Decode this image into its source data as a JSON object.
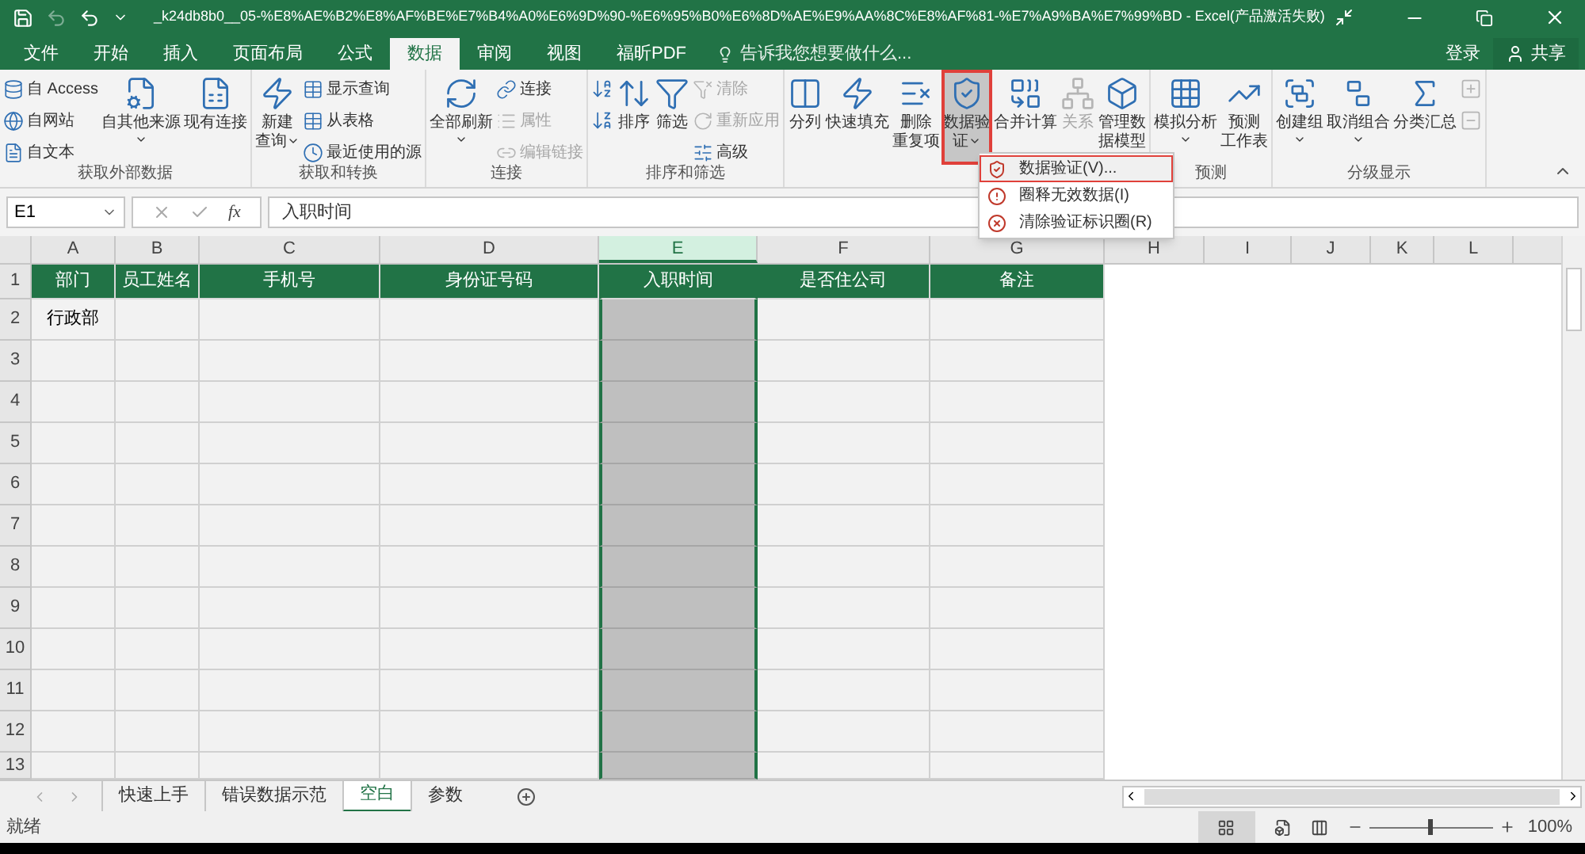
{
  "window": {
    "title": "_k24db8b0__05-%E8%AE%B2%E8%AF%BE%E7%B4%A0%E6%9D%90-%E6%95%B0%E6%8D%AE%E9%AA%8C%E8%AF%81-%E7%A9%BA%E7%99%BD - Excel(产品激活失败)"
  },
  "tabs": [
    {
      "label": "文件",
      "selected": false
    },
    {
      "label": "开始",
      "selected": false
    },
    {
      "label": "插入",
      "selected": false
    },
    {
      "label": "页面布局",
      "selected": false
    },
    {
      "label": "公式",
      "selected": false
    },
    {
      "label": "数据",
      "selected": true
    },
    {
      "label": "审阅",
      "selected": false
    },
    {
      "label": "视图",
      "selected": false
    },
    {
      "label": "福昕PDF",
      "selected": false
    }
  ],
  "tell_me": {
    "placeholder": "告诉我您想要做什么..."
  },
  "account": {
    "sign_in": "登录",
    "share": "共享"
  },
  "ribbon": {
    "groups": [
      {
        "label": "获取外部数据",
        "items": [
          {
            "kind": "stack",
            "items": [
              {
                "kind": "small",
                "label": "自 Access",
                "disabled": false
              },
              {
                "kind": "small",
                "label": "自网站",
                "disabled": false
              },
              {
                "kind": "small",
                "label": "自文本",
                "disabled": false
              }
            ]
          },
          {
            "kind": "large",
            "label": "自其他来源",
            "dropdown": true,
            "disabled": false,
            "selected": false
          },
          {
            "kind": "large",
            "label": "现有连接",
            "dropdown": false,
            "disabled": false,
            "selected": false
          }
        ]
      },
      {
        "label": "获取和转换",
        "items": [
          {
            "kind": "large",
            "label": "新建查询",
            "dropdown": true,
            "disabled": false,
            "selected": false
          },
          {
            "kind": "stack",
            "items": [
              {
                "kind": "small",
                "label": "显示查询",
                "disabled": false
              },
              {
                "kind": "small",
                "label": "从表格",
                "disabled": false
              },
              {
                "kind": "small",
                "label": "最近使用的源",
                "disabled": false
              }
            ]
          }
        ]
      },
      {
        "label": "连接",
        "items": [
          {
            "kind": "large",
            "label": "全部刷新",
            "dropdown": true,
            "disabled": false,
            "selected": false
          },
          {
            "kind": "stack",
            "items": [
              {
                "kind": "small",
                "label": "连接",
                "disabled": false
              },
              {
                "kind": "small",
                "label": "属性",
                "disabled": true
              },
              {
                "kind": "small",
                "label": "编辑链接",
                "disabled": true
              }
            ]
          }
        ]
      },
      {
        "label": "排序和筛选",
        "items": [
          {
            "kind": "stack",
            "items": [
              {
                "kind": "icon",
                "disabled": false
              },
              {
                "kind": "icon",
                "disabled": false
              }
            ]
          },
          {
            "kind": "large",
            "label": "排序",
            "dropdown": false,
            "disabled": false,
            "selected": false
          },
          {
            "kind": "large",
            "label": "筛选",
            "dropdown": false,
            "disabled": false,
            "selected": false
          },
          {
            "kind": "stack",
            "items": [
              {
                "kind": "small",
                "label": "清除",
                "disabled": true
              },
              {
                "kind": "small",
                "label": "重新应用",
                "disabled": true
              },
              {
                "kind": "small",
                "label": "高级",
                "disabled": false
              }
            ]
          }
        ]
      },
      {
        "items": [
          {
            "kind": "large",
            "label": "分列",
            "dropdown": false,
            "disabled": false,
            "selected": false
          },
          {
            "kind": "large",
            "label": "快速填充",
            "dropdown": false,
            "disabled": false,
            "selected": false
          },
          {
            "kind": "large",
            "label": "删除重复项",
            "dropdown": false,
            "disabled": false,
            "selected": false
          },
          {
            "kind": "large",
            "label": "数据验证",
            "dropdown": true,
            "disabled": false,
            "selected": true
          },
          {
            "kind": "large",
            "label": "合并计算",
            "dropdown": false,
            "disabled": false,
            "selected": false
          },
          {
            "kind": "large",
            "label": "关系",
            "dropdown": false,
            "disabled": true,
            "selected": false
          },
          {
            "kind": "large",
            "label": "管理数据模型",
            "dropdown": false,
            "disabled": false,
            "selected": false
          }
        ]
      },
      {
        "label": "预测",
        "items": [
          {
            "kind": "large",
            "label": "模拟分析",
            "dropdown": true,
            "disabled": false,
            "selected": false
          },
          {
            "kind": "large",
            "label": "预测工作表",
            "dropdown": false,
            "disabled": false,
            "selected": false
          }
        ]
      },
      {
        "label": "分级显示",
        "items": [
          {
            "kind": "large",
            "label": "创建组",
            "dropdown": true,
            "disabled": false,
            "selected": false
          },
          {
            "kind": "large",
            "label": "取消组合",
            "dropdown": true,
            "disabled": false,
            "selected": false
          },
          {
            "kind": "large",
            "label": "分类汇总",
            "dropdown": false,
            "disabled": false,
            "selected": false
          },
          {
            "kind": "stack",
            "items": [
              {
                "kind": "icon",
                "disabled": true
              },
              {
                "kind": "icon",
                "disabled": true
              }
            ]
          }
        ]
      }
    ]
  },
  "menu": [
    {
      "label": "数据验证(V)...",
      "selected": true
    },
    {
      "label": "圈释无效数据(I)",
      "selected": false
    },
    {
      "label": "清除验证标识圈(R)",
      "selected": false
    }
  ],
  "formula_bar": {
    "name_box": "E1",
    "function_label": "fx",
    "value": "入职时间"
  },
  "columns": [
    {
      "label": "A",
      "selected": false
    },
    {
      "label": "B",
      "selected": false
    },
    {
      "label": "C",
      "selected": false
    },
    {
      "label": "D",
      "selected": false
    },
    {
      "label": "E",
      "selected": true
    },
    {
      "label": "F",
      "selected": false
    },
    {
      "label": "G",
      "selected": false
    },
    {
      "label": "H",
      "selected": false
    },
    {
      "label": "I",
      "selected": false
    },
    {
      "label": "J",
      "selected": false
    },
    {
      "label": "K",
      "selected": false
    },
    {
      "label": "L",
      "selected": false
    }
  ],
  "rows": [
    {
      "number": "1",
      "kind": "header",
      "cells": [
        "部门",
        "员工姓名",
        "手机号",
        "身份证号码",
        "入职时间",
        "是否住公司",
        "备注"
      ]
    },
    {
      "number": "2",
      "kind": "data",
      "cells": [
        "行政部"
      ]
    },
    {
      "number": "3",
      "kind": "data"
    },
    {
      "number": "4",
      "kind": "data"
    },
    {
      "number": "5",
      "kind": "data"
    },
    {
      "number": "6",
      "kind": "data"
    },
    {
      "number": "7",
      "kind": "data"
    },
    {
      "number": "8",
      "kind": "data"
    },
    {
      "number": "9",
      "kind": "data"
    },
    {
      "number": "10",
      "kind": "data"
    },
    {
      "number": "11",
      "kind": "data"
    },
    {
      "number": "12",
      "kind": "data"
    },
    {
      "number": "13",
      "kind": "data"
    }
  ],
  "sheet_tabs": [
    {
      "label": "快速上手",
      "selected": false
    },
    {
      "label": "错误数据示范",
      "selected": false
    },
    {
      "label": "空白",
      "selected": true
    },
    {
      "label": "参数",
      "selected": false
    }
  ],
  "status_bar": {
    "status": "就绪",
    "zoom": "100%",
    "zoom_slider": {
      "level": 0.5
    }
  }
}
